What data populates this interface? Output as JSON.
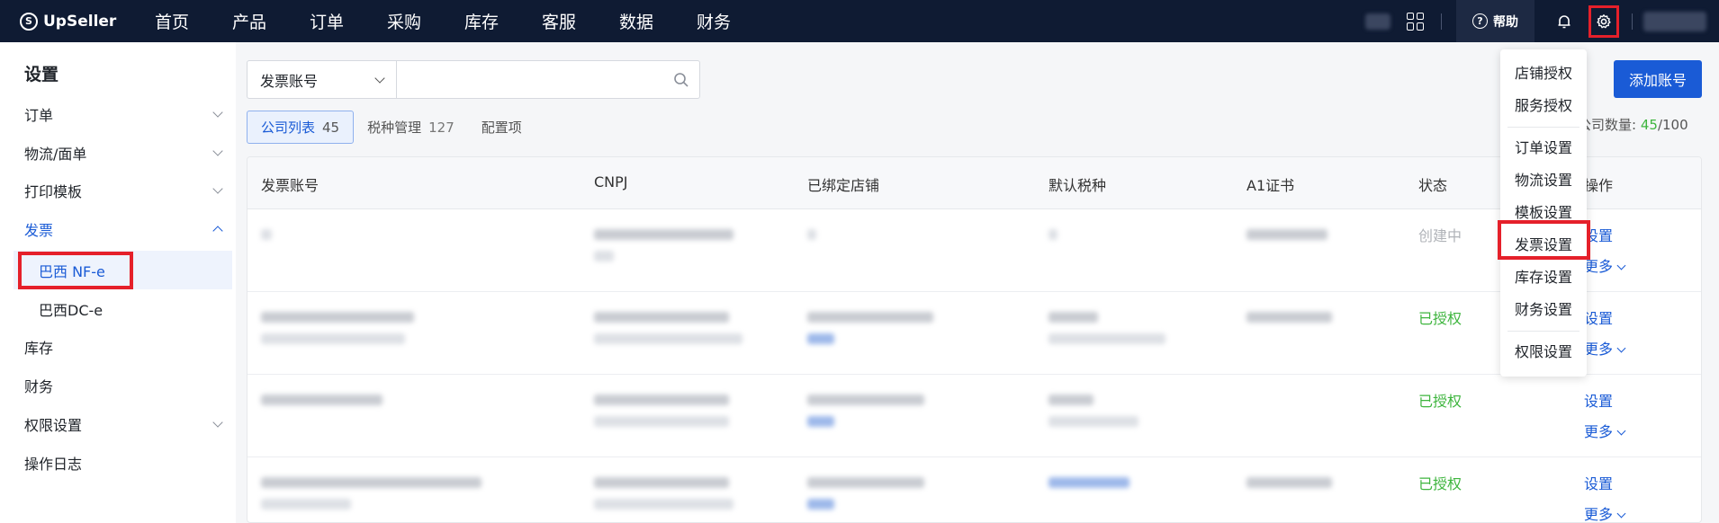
{
  "header": {
    "logo": "UpSeller",
    "nav": [
      "首页",
      "产品",
      "订单",
      "采购",
      "库存",
      "客服",
      "数据",
      "财务"
    ],
    "help_label": "帮助",
    "icons": [
      "apps-grid-icon",
      "help-icon",
      "bell-icon",
      "gear-icon"
    ]
  },
  "sidebar": {
    "title": "设置",
    "items": [
      {
        "label": "订单"
      },
      {
        "label": "物流/面单"
      },
      {
        "label": "打印模板"
      },
      {
        "label": "发票"
      },
      {
        "label": "巴西 NF-e"
      },
      {
        "label": "巴西DC-e"
      },
      {
        "label": "库存"
      },
      {
        "label": "财务"
      },
      {
        "label": "权限设置"
      },
      {
        "label": "操作日志"
      }
    ]
  },
  "search": {
    "select_value": "发票账号",
    "input_value": "",
    "placeholder": ""
  },
  "tabs": [
    {
      "label": "公司列表",
      "count": "45"
    },
    {
      "label": "税种管理",
      "count": "127"
    },
    {
      "label": "配置项",
      "count": ""
    }
  ],
  "add_button": "添加账号",
  "company_count": {
    "label": "公司数量:",
    "current": "45",
    "total": "/100"
  },
  "table": {
    "columns": [
      "发票账号",
      "CNPJ",
      "已绑定店铺",
      "默认税种",
      "A1证书",
      "状态",
      "操作"
    ],
    "rows": [
      {
        "status": "创建中",
        "actions": [
          "设置",
          "更多"
        ]
      },
      {
        "status": "已授权",
        "actions": [
          "设置",
          "更多"
        ]
      },
      {
        "status": "已授权",
        "actions": [
          "设置",
          "更多"
        ]
      },
      {
        "status": "已授权",
        "actions": [
          "设置",
          "更多"
        ]
      }
    ]
  },
  "settings_menu": {
    "items": [
      "店铺授权",
      "服务授权",
      "订单设置",
      "物流设置",
      "模板设置",
      "发票设置",
      "库存设置",
      "财务设置",
      "权限设置"
    ]
  },
  "colors": {
    "accent": "#1a5bd6",
    "header_bg": "#0f1b33",
    "highlight": "#e5202a",
    "success": "#3eb53e"
  }
}
